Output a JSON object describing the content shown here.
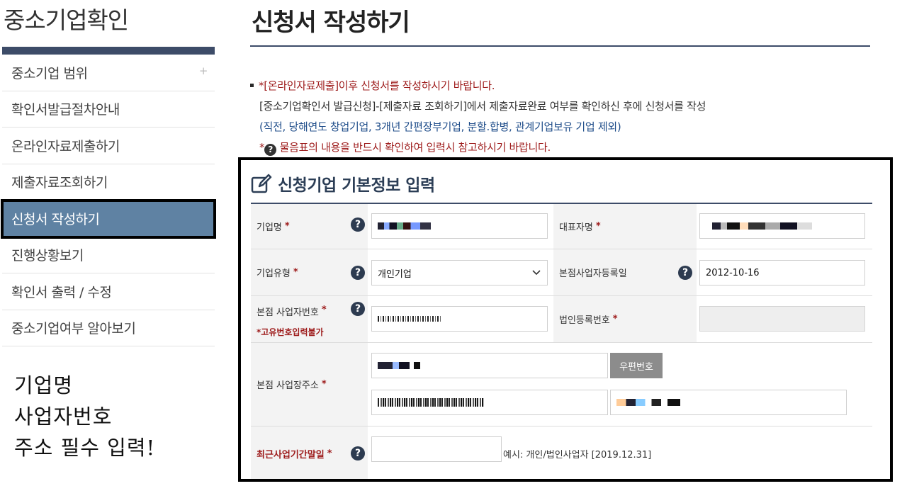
{
  "sidebar": {
    "title": "중소기업확인",
    "items": [
      {
        "label": "중소기업 범위",
        "plus": "+"
      },
      {
        "label": "확인서발급절차안내"
      },
      {
        "label": "온라인자료제출하기"
      },
      {
        "label": "제출자료조회하기"
      },
      {
        "label": "신청서 작성하기"
      },
      {
        "label": "진행상황보기"
      },
      {
        "label": "확인서 출력 / 수정"
      },
      {
        "label": "중소기업여부 알아보기"
      }
    ]
  },
  "annotation": {
    "line1": "기업명",
    "line2": "사업자번호",
    "line3": "주소 필수 입력!"
  },
  "main": {
    "title": "신청서 작성하기",
    "notice": {
      "line1": "*[온라인자료제출]이후 신청서를 작성하시기 바랍니다.",
      "line2": "[중소기업확인서 발급신청]-[제출자료 조회하기]에서 제출자료완료 여부를 확인하신 후에 신청서를 작성",
      "line3": "(직전, 당해연도 창업기업, 3개년 간편장부기업, 분할.합병, 관계기업보유 기업 제외)",
      "line4_prefix": "*",
      "line4_icon": "?",
      "line4_text": "물음표의 내용을 반드시 확인하여 입력시 참고하시기 바랍니다."
    }
  },
  "form": {
    "heading": "신청기업 기본정보 입력",
    "required_mark": "*",
    "help_icon": "?",
    "company_name_label": "기업명",
    "ceo_name_label": "대표자명",
    "company_type_label": "기업유형",
    "company_type_value": "개인기업",
    "hq_reg_date_label": "본점사업자등록일",
    "hq_reg_date_value": "2012-10-16",
    "hq_bizno_label": "본점 사업자번호",
    "hq_bizno_subnote": "*고유번호입력불가",
    "corp_regno_label": "법인등록번호",
    "hq_address_label": "본점 사업장주소",
    "zip_button": "우편번호",
    "last_fiscal_label": "최근사업기간말일",
    "last_fiscal_hint": "예시: 개인/법인사업자 [2019.12.31]"
  },
  "colors": {
    "navy": "#3d4c68",
    "active_menu": "#5f82a3",
    "required_red": "#9d1a1a",
    "notice_blue": "#1f4d8a"
  }
}
